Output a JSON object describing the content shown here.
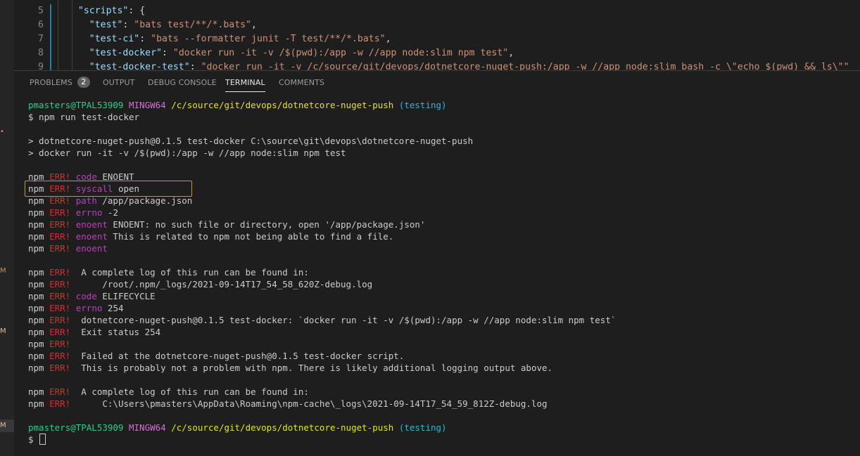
{
  "editor": {
    "lines": [
      {
        "num": "5",
        "indent": "  ",
        "key": "\"scripts\"",
        "sep": ": ",
        "value": "",
        "tail": "{"
      },
      {
        "num": "6",
        "indent": "    ",
        "key": "\"test\"",
        "sep": ": ",
        "value": "\"bats test/**/*.bats\"",
        "tail": ","
      },
      {
        "num": "7",
        "indent": "    ",
        "key": "\"test-ci\"",
        "sep": ": ",
        "value": "\"bats --formatter junit -T test/**/*.bats\"",
        "tail": ","
      },
      {
        "num": "8",
        "indent": "    ",
        "key": "\"test-docker\"",
        "sep": ": ",
        "value": "\"docker run -it -v /$(pwd):/app -w //app node:slim npm test\"",
        "tail": ","
      },
      {
        "num": "9",
        "indent": "    ",
        "key": "\"test-docker-test\"",
        "sep": ": ",
        "value": "\"docker run -it -v /c/source/git/devops/dotnetcore-nuget-push:/app -w //app node:slim bash -c \\\"echo $(pwd) && ls\\\"\"",
        "tail": ""
      }
    ]
  },
  "panel": {
    "tabs": [
      {
        "label": "PROBLEMS",
        "badge": "2",
        "active": false
      },
      {
        "label": "OUTPUT",
        "active": false
      },
      {
        "label": "DEBUG CONSOLE",
        "active": false
      },
      {
        "label": "TERMINAL",
        "active": true
      },
      {
        "label": "COMMENTS",
        "active": false
      }
    ]
  },
  "sidebar": {
    "markers": [
      "M",
      "M",
      "M"
    ]
  },
  "terminal": {
    "prompt1": {
      "user": "pmasters@TPAL53909",
      "host": "MINGW64",
      "cwd": "/c/source/git/devops/dotnetcore-nuget-push",
      "branch": "(testing)"
    },
    "command1": "$ npm run test-docker",
    "script_lines": [
      "> dotnetcore-nuget-push@0.1.5 test-docker C:\\source\\git\\devops\\dotnetcore-nuget-push",
      "> docker run -it -v /$(pwd):/app -w //app node:slim npm test"
    ],
    "npm_block1": [
      {
        "kw": "code",
        "text": " ENOENT"
      },
      {
        "kw": "syscall",
        "text": " open"
      },
      {
        "kw": "path",
        "text": " /app/package.json"
      },
      {
        "kw": "errno",
        "text": " -2"
      },
      {
        "kw": "enoent",
        "text": " ENOENT: no such file or directory, open '/app/package.json'"
      },
      {
        "kw": "enoent",
        "text": " This is related to npm not being able to find a file."
      },
      {
        "kw": "enoent",
        "text": ""
      }
    ],
    "npm_block2": [
      {
        "kw": "",
        "text": " A complete log of this run can be found in:"
      },
      {
        "kw": "",
        "text": "     /root/.npm/_logs/2021-09-14T17_54_58_620Z-debug.log"
      },
      {
        "kw": "code",
        "text": " ELIFECYCLE"
      },
      {
        "kw": "errno",
        "text": " 254"
      },
      {
        "kw": "",
        "text": " dotnetcore-nuget-push@0.1.5 test-docker: `docker run -it -v /$(pwd):/app -w //app node:slim npm test`"
      },
      {
        "kw": "",
        "text": " Exit status 254"
      },
      {
        "kw": "",
        "text": ""
      },
      {
        "kw": "",
        "text": " Failed at the dotnetcore-nuget-push@0.1.5 test-docker script."
      },
      {
        "kw": "",
        "text": " This is probably not a problem with npm. There is likely additional logging output above."
      }
    ],
    "npm_block3": [
      {
        "kw": "",
        "text": " A complete log of this run can be found in:"
      },
      {
        "kw": "",
        "text": "     C:\\Users\\pmasters\\AppData\\Roaming\\npm-cache\\_logs\\2021-09-14T17_54_59_812Z-debug.log"
      }
    ],
    "npm_prefix": "npm",
    "err_label": "ERR!",
    "prompt2": {
      "user": "pmasters@TPAL53909",
      "host": "MINGW64",
      "cwd": "/c/source/git/devops/dotnetcore-nuget-push",
      "branch": "(testing)"
    },
    "command2": "$ "
  },
  "colors": {
    "error": "#cd3131",
    "keyword": "#bc3fbc",
    "user": "#23d18b",
    "host": "#d670d6",
    "cwd": "#e5e510",
    "branch": "#29b8db",
    "highlight_border": "#c59a2c"
  }
}
